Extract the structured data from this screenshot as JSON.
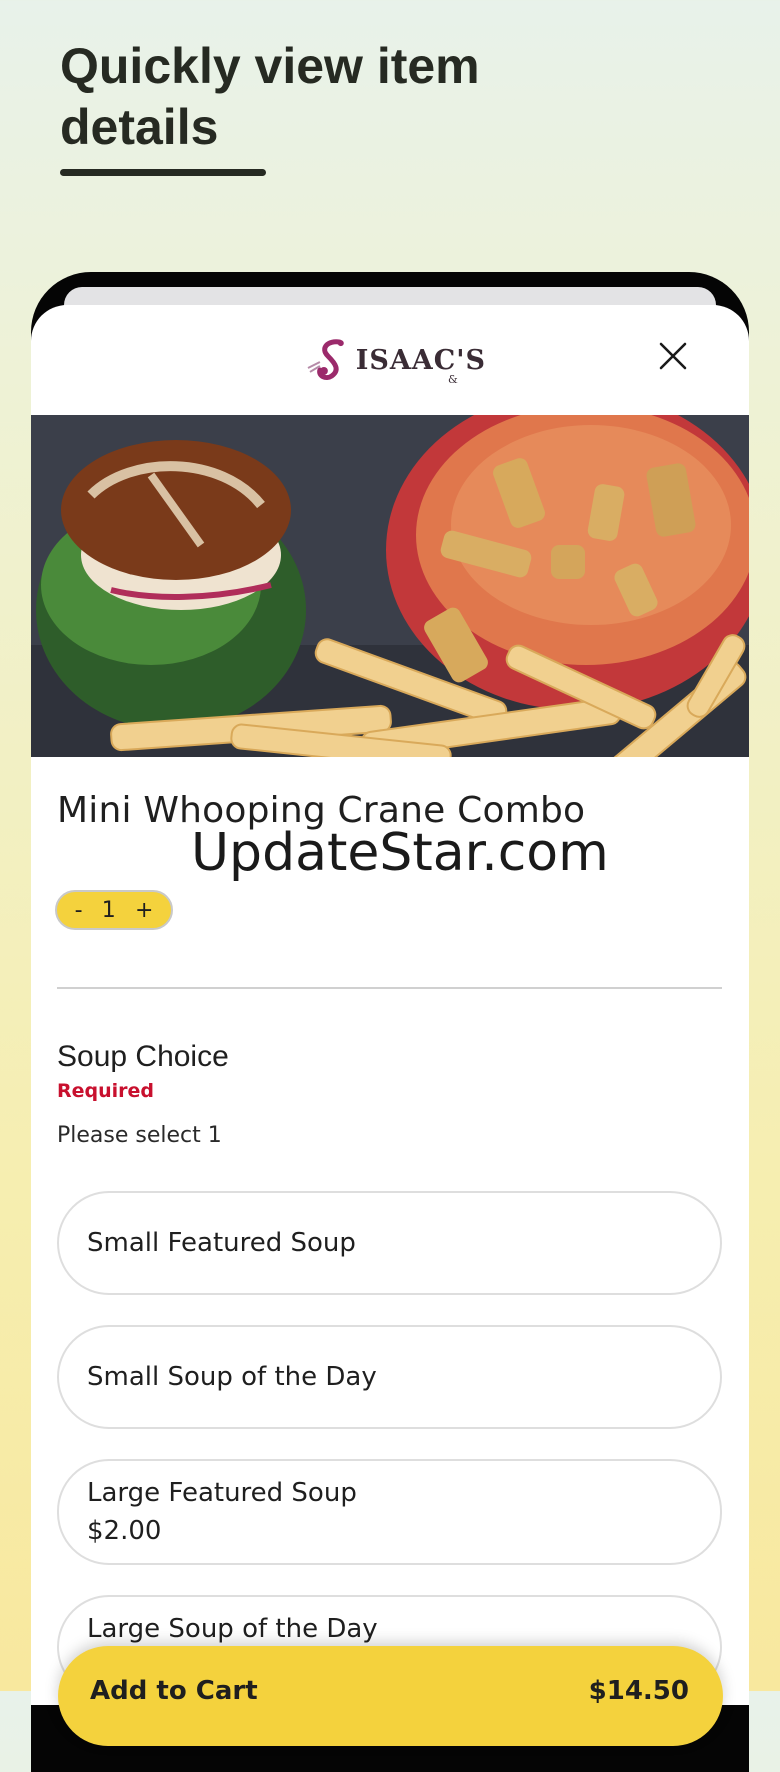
{
  "promo": {
    "headline": "Quickly view item details"
  },
  "brand": {
    "name": "ISAAC'S",
    "ampersand": "&",
    "logo_icon": "saxophone-s-logo",
    "color": "#9b2a6b"
  },
  "item": {
    "title": "Mini Whooping Crane Combo",
    "photo_description_icon": "food-photo",
    "quantity": "1",
    "qty_minus": "-",
    "qty_plus": "+"
  },
  "watermark": {
    "text": "UpdateStar.com"
  },
  "soup_section": {
    "title": "Soup Choice",
    "required_label": "Required",
    "hint": "Please select 1",
    "options": [
      {
        "label": "Small Featured Soup",
        "price": ""
      },
      {
        "label": "Small Soup of the Day",
        "price": ""
      },
      {
        "label": "Large Featured Soup",
        "price": "$2.00"
      },
      {
        "label": "Large Soup of the Day",
        "price": ""
      }
    ]
  },
  "cart": {
    "button_label": "Add to Cart",
    "total": "$14.50"
  },
  "colors": {
    "accent_yellow": "#f4d23d",
    "required_red": "#c8102e"
  }
}
